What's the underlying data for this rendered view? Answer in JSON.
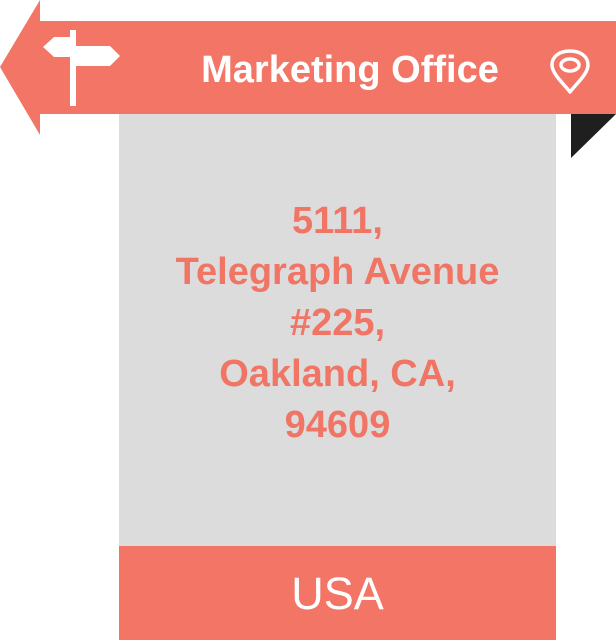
{
  "banner": {
    "title": "Marketing Office",
    "icon_left": "signpost-icon",
    "icon_right": "location-pin-icon"
  },
  "address": {
    "lines": [
      "5111,",
      "Telegraph Avenue",
      "#225,",
      "Oakland, CA,",
      "94609"
    ]
  },
  "country": "USA",
  "colors": {
    "accent": "#f37566",
    "address_text": "#f07565",
    "card_background": "#dcdcdc",
    "fold": "#1f1f1f",
    "white": "#ffffff"
  }
}
